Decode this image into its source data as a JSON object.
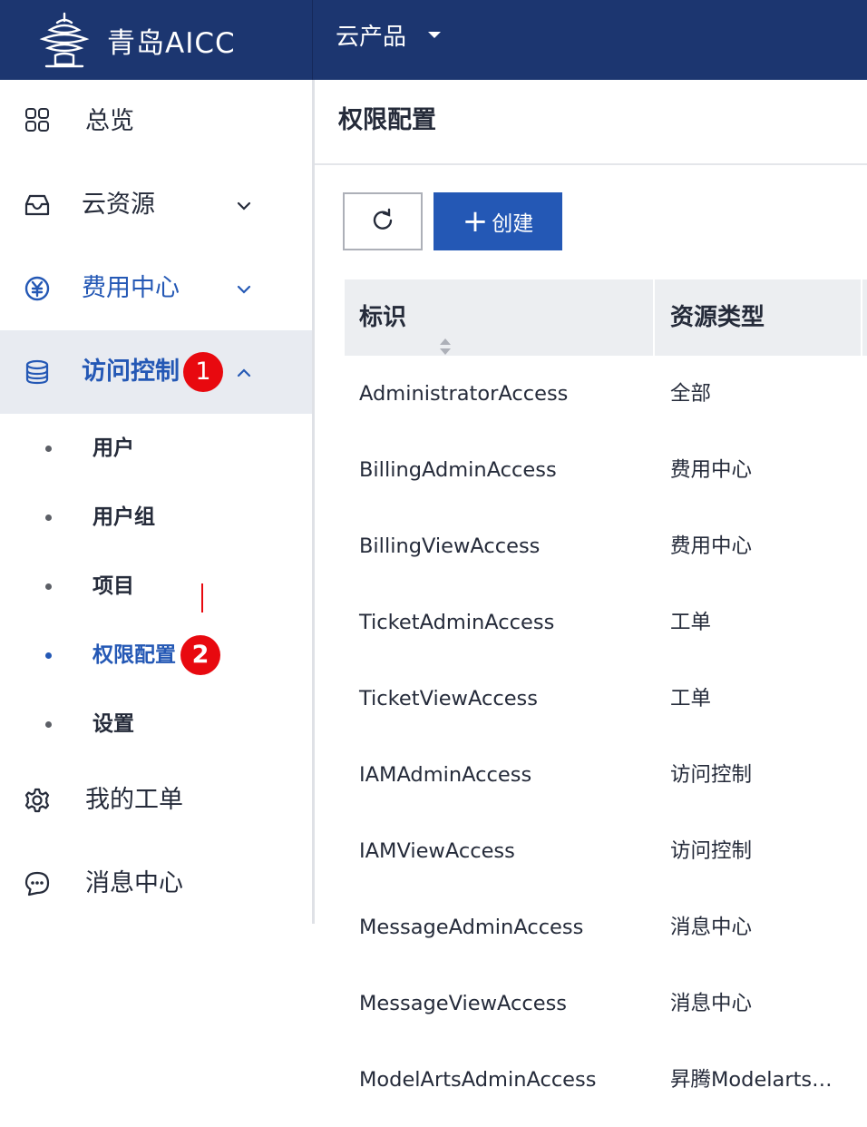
{
  "header": {
    "brand": "青岛AICC",
    "product_menu": "云产品",
    "logo_icon": "qingdao-tower-logo-icon",
    "bg_color": "#1c3670"
  },
  "sidebar": {
    "items": [
      {
        "label": "总览",
        "icon": "grid-icon"
      },
      {
        "label": "云资源",
        "icon": "inbox-icon"
      },
      {
        "label": "费用中心",
        "icon": "yuan-circle-icon"
      },
      {
        "label": "访问控制",
        "icon": "database-icon",
        "badge": "1"
      },
      {
        "label": "我的工单",
        "icon": "gear-icon"
      },
      {
        "label": "消息中心",
        "icon": "chat-bubble-icon"
      }
    ],
    "sub_items": [
      {
        "label": "用户"
      },
      {
        "label": "用户组"
      },
      {
        "label": "项目"
      },
      {
        "label": "权限配置",
        "badge": "2"
      },
      {
        "label": "设置"
      }
    ]
  },
  "main": {
    "title": "权限配置",
    "create_label": "创建",
    "table": {
      "columns": [
        "标识",
        "资源类型"
      ],
      "rows": [
        {
          "id": "AdministratorAccess",
          "type": "全部"
        },
        {
          "id": "BillingAdminAccess",
          "type": "费用中心"
        },
        {
          "id": "BillingViewAccess",
          "type": "费用中心"
        },
        {
          "id": "TicketAdminAccess",
          "type": "工单"
        },
        {
          "id": "TicketViewAccess",
          "type": "工单"
        },
        {
          "id": "IAMAdminAccess",
          "type": "访问控制"
        },
        {
          "id": "IAMViewAccess",
          "type": "访问控制"
        },
        {
          "id": "MessageAdminAccess",
          "type": "消息中心"
        },
        {
          "id": "MessageViewAccess",
          "type": "消息中心"
        },
        {
          "id": "ModelArtsAdminAccess",
          "type": "昇腾Modelarts…"
        }
      ]
    }
  },
  "colors": {
    "primary": "#2458b5",
    "badge": "#e8090f",
    "active_bg": "#e8ebf1"
  }
}
